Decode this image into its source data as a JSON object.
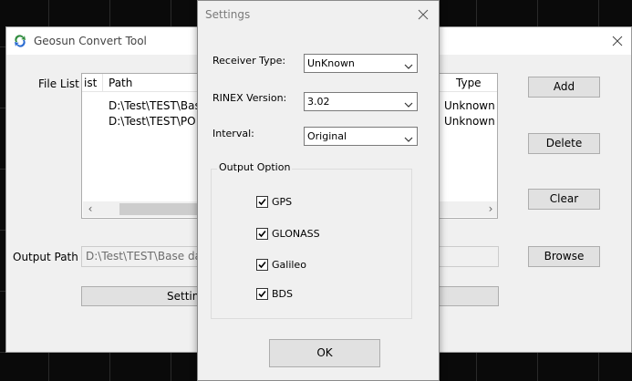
{
  "main": {
    "title": "Geosun Convert Tool",
    "file_list_label": "File List",
    "columns": [
      "ist",
      "Path",
      "Type"
    ],
    "rows": [
      {
        "path": "D:\\Test\\TEST\\Bas",
        "type": "Unknown"
      },
      {
        "path": "D:\\Test\\TEST\\PO",
        "type": "Unknown"
      }
    ],
    "output_path_label": "Output Path",
    "output_path_value": "D:\\Test\\TEST\\Base da",
    "buttons": {
      "add": "Add",
      "delete": "Delete",
      "clear": "Clear",
      "browse": "Browse",
      "settings": "Settin"
    }
  },
  "dialog": {
    "title": "Settings",
    "receiver_type_label": "Receiver Type:",
    "receiver_type_value": "UnKnown",
    "rinex_version_label": "RINEX Version:",
    "rinex_version_value": "3.02",
    "interval_label": "Interval:",
    "interval_value": "Original",
    "output_option_label": "Output Option",
    "options": [
      {
        "label": "GPS",
        "checked": true
      },
      {
        "label": "GLONASS",
        "checked": true
      },
      {
        "label": "Galileo",
        "checked": true
      },
      {
        "label": "BDS",
        "checked": true
      }
    ],
    "ok_label": "OK"
  },
  "icons": {
    "app": "convert-tool-icon",
    "close": "close-icon",
    "dropdown": "chevron-down-icon",
    "check": "checkmark-icon"
  },
  "colors": {
    "desktop": "#0a0a0a",
    "window": "#f0f0f0",
    "button": "#e1e1e1"
  }
}
